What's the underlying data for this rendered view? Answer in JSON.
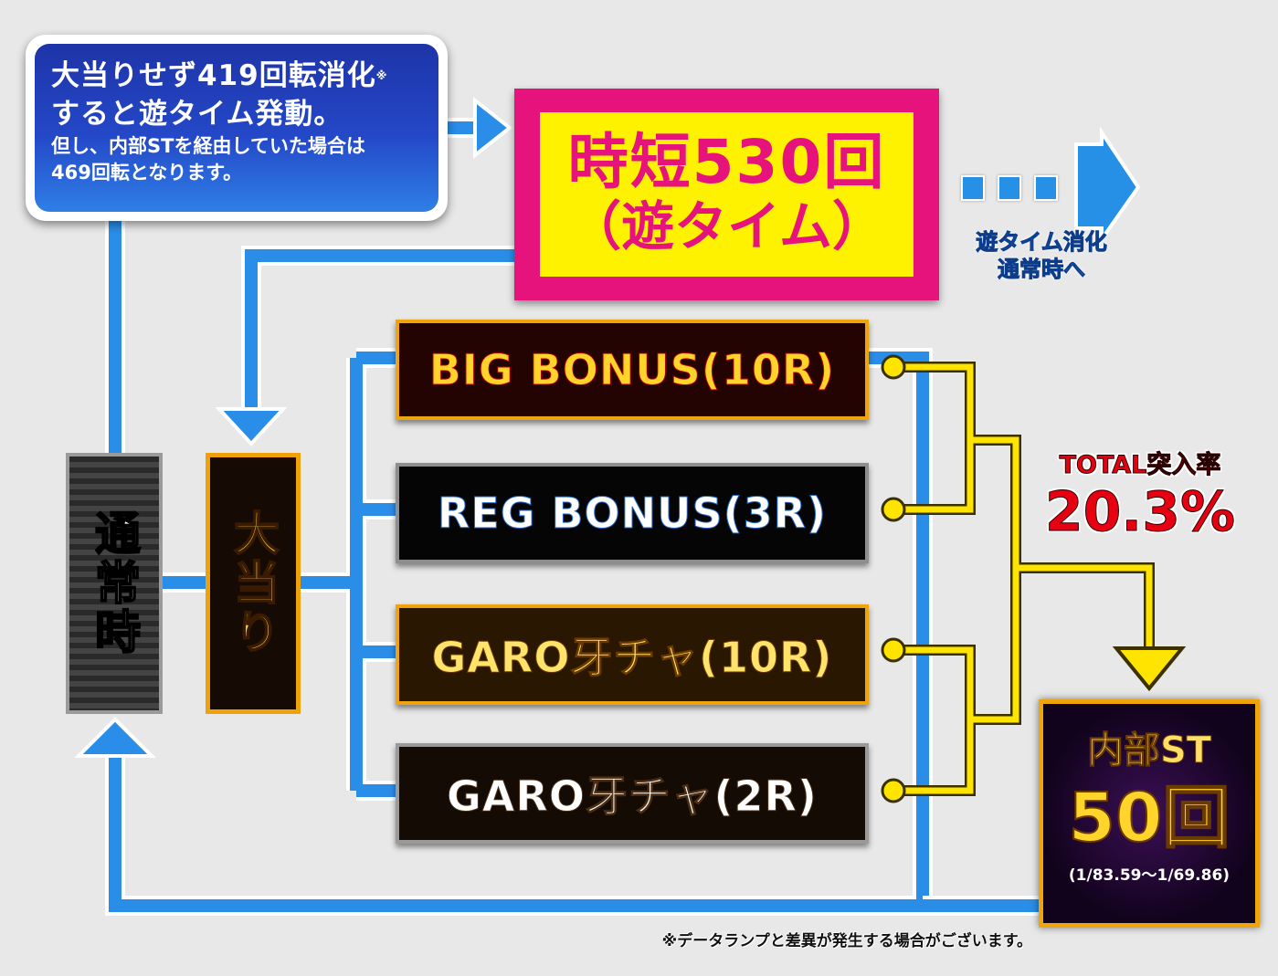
{
  "info": {
    "line1": "大当りせず419回転消化",
    "note_mark": "※",
    "line2": "すると遊タイム発動。",
    "line3": "但し、内部STを経由していた場合は",
    "line4": "469回転となります。"
  },
  "jitan": {
    "line1": "時短530回",
    "line2": "（遊タイム）"
  },
  "after": {
    "line1": "遊タイム消化",
    "line2": "通常時へ"
  },
  "normal_label": "通常時",
  "hit_label": "大当り",
  "bonuses": [
    {
      "label": "BIG BONUS(10R)"
    },
    {
      "label": "REG BONUS(3R)"
    },
    {
      "label": "GARO牙チャ(10R)"
    },
    {
      "label": "GARO牙チャ(2R)"
    }
  ],
  "total": {
    "label": "TOTAL突入率",
    "rate": "20.3%"
  },
  "st": {
    "title": "内部ST",
    "count": "50回",
    "prob": "(1/83.59～1/69.86)"
  },
  "footnote": "※データランプと差異が発生する場合がございます。",
  "colors": {
    "blue_route": "#2a8de8",
    "yellow_route": "#ffe400",
    "jitan_frame": "#e6137c",
    "jitan_fill": "#fff200",
    "total_red": "#e60012"
  }
}
